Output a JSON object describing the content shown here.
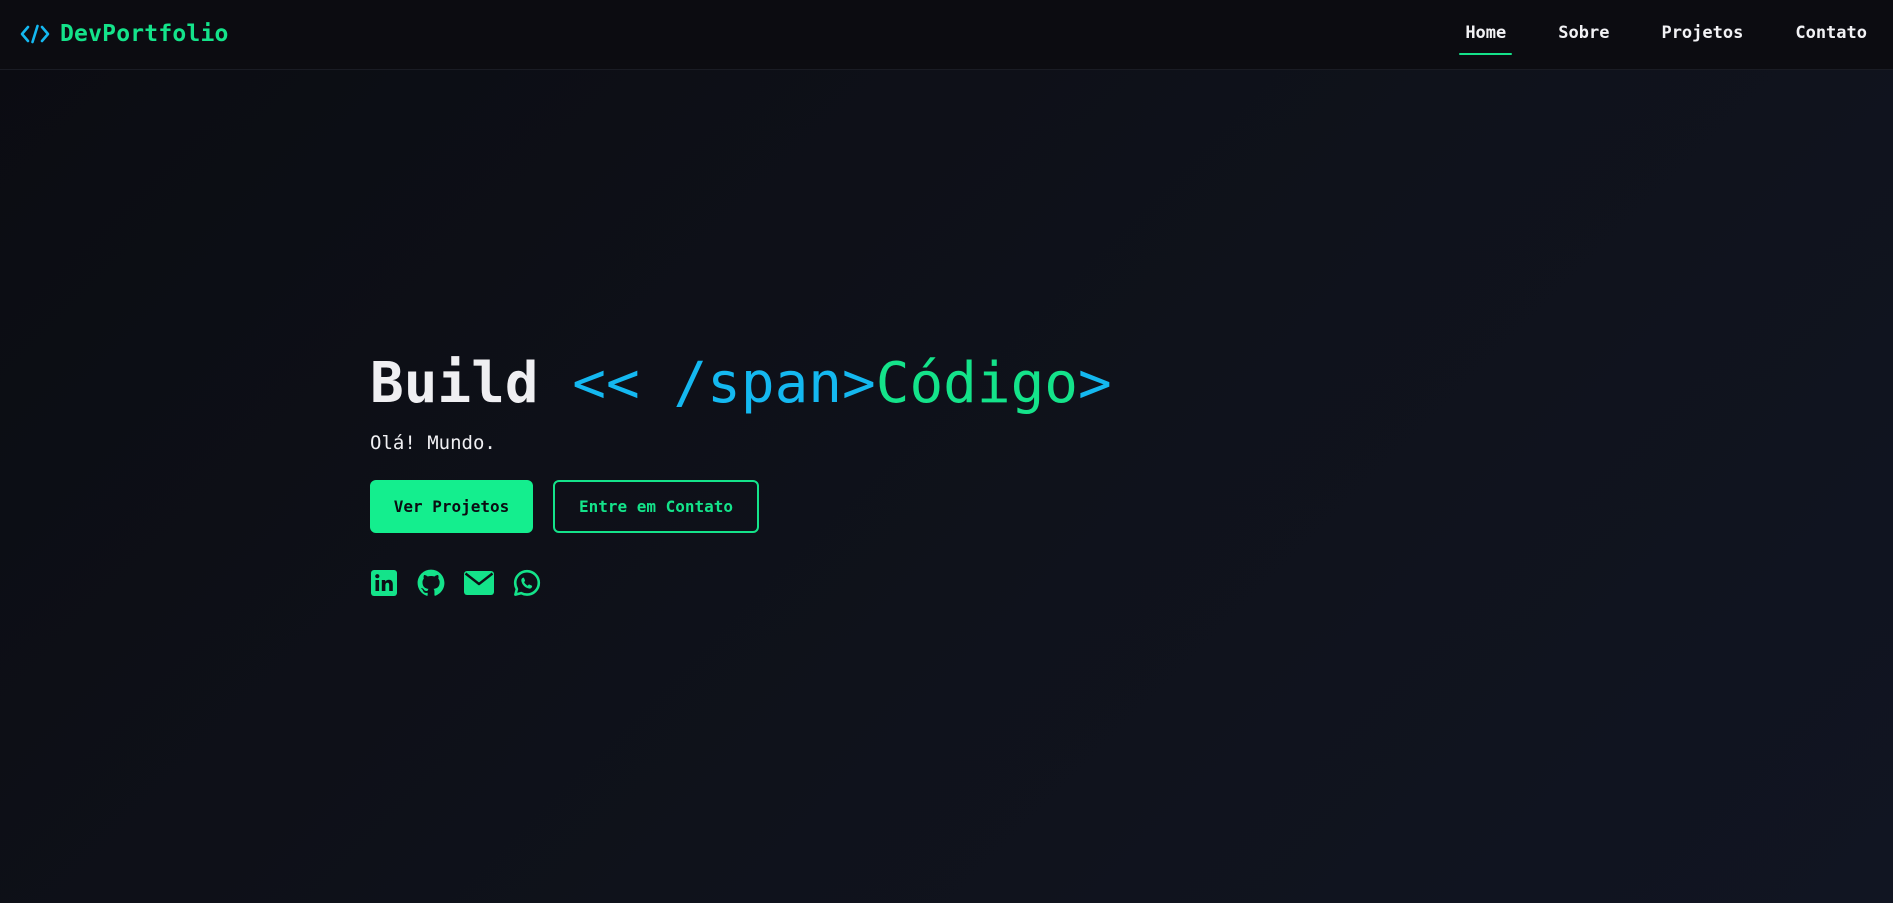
{
  "brand": {
    "icon": "code-brackets-icon",
    "icon_text": "</>",
    "name": "DevPortfolio",
    "color": "#14e38a",
    "icon_color": "#14b8f0"
  },
  "nav": {
    "items": [
      {
        "label": "Home",
        "active": true
      },
      {
        "label": "Sobre",
        "active": false
      },
      {
        "label": "Projetos",
        "active": false
      },
      {
        "label": "Contato",
        "active": false
      }
    ]
  },
  "hero": {
    "title_word": "Build",
    "title_tag_open": "<< /span>",
    "title_accent": "Código",
    "title_tag_close": ">",
    "subtitle": "Olá! Mundo.",
    "primary_button": "Ver Projetos",
    "secondary_button": "Entre em Contato"
  },
  "socials": [
    {
      "icon": "linkedin-icon"
    },
    {
      "icon": "github-icon"
    },
    {
      "icon": "email-icon"
    },
    {
      "icon": "whatsapp-icon"
    }
  ],
  "colors": {
    "accent_green": "#14e38a",
    "accent_blue": "#14b8f0",
    "background": "#0d0f16"
  }
}
